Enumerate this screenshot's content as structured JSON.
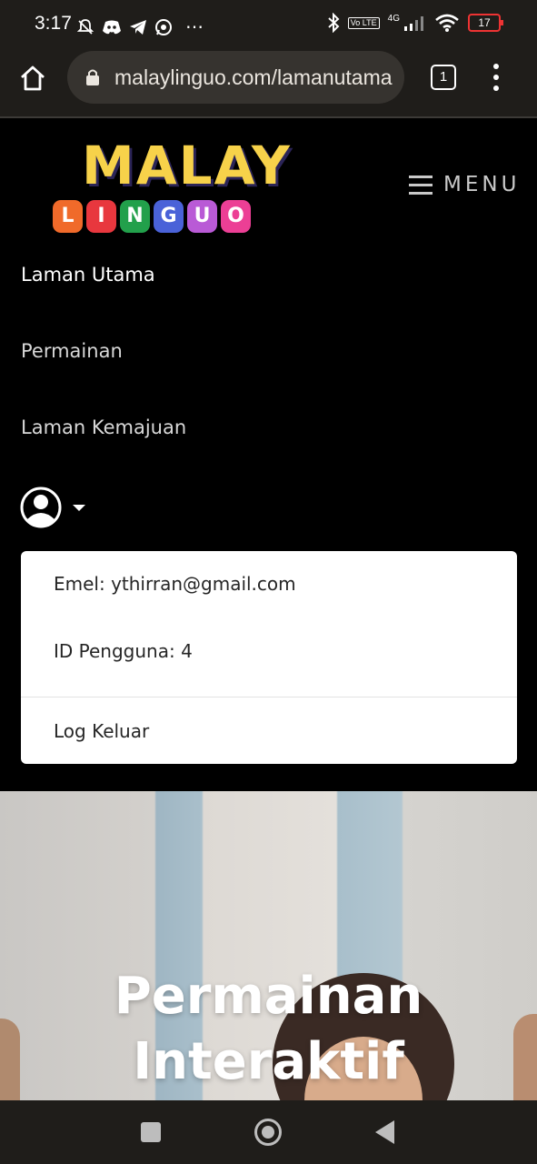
{
  "status_bar": {
    "time": "3:17",
    "network": "4G",
    "volte": "Vo LTE",
    "battery": "17",
    "overflow": "⋯",
    "icons": [
      "muted-bell-icon",
      "discord-icon",
      "telegram-icon",
      "whatsapp-icon",
      "bluetooth-icon",
      "signal-icon",
      "wifi-icon",
      "battery-icon"
    ]
  },
  "browser": {
    "url": "malaylinguo.com/lamanutama",
    "tab_count": "1",
    "icons": [
      "home-icon",
      "lock-icon",
      "tabs-icon",
      "more-vert-icon"
    ]
  },
  "header": {
    "logo_word": "MALAY",
    "logo_letters": [
      {
        "letter": "L",
        "color": "#f06a2a"
      },
      {
        "letter": "I",
        "color": "#e8373e"
      },
      {
        "letter": "N",
        "color": "#22a04b"
      },
      {
        "letter": "G",
        "color": "#4a62d8"
      },
      {
        "letter": "U",
        "color": "#b95ad6"
      },
      {
        "letter": "O",
        "color": "#ec3f95"
      }
    ],
    "menu_label": "MENU"
  },
  "nav": {
    "items": [
      "Laman Utama",
      "Permainan",
      "Laman Kemajuan"
    ]
  },
  "user_menu": {
    "email": "Emel: ythirran@gmail.com",
    "user_id": "ID Pengguna: 4",
    "logout": "Log Keluar"
  },
  "hero": {
    "title_line1": "Permainan",
    "title_line2": "Interaktif"
  }
}
